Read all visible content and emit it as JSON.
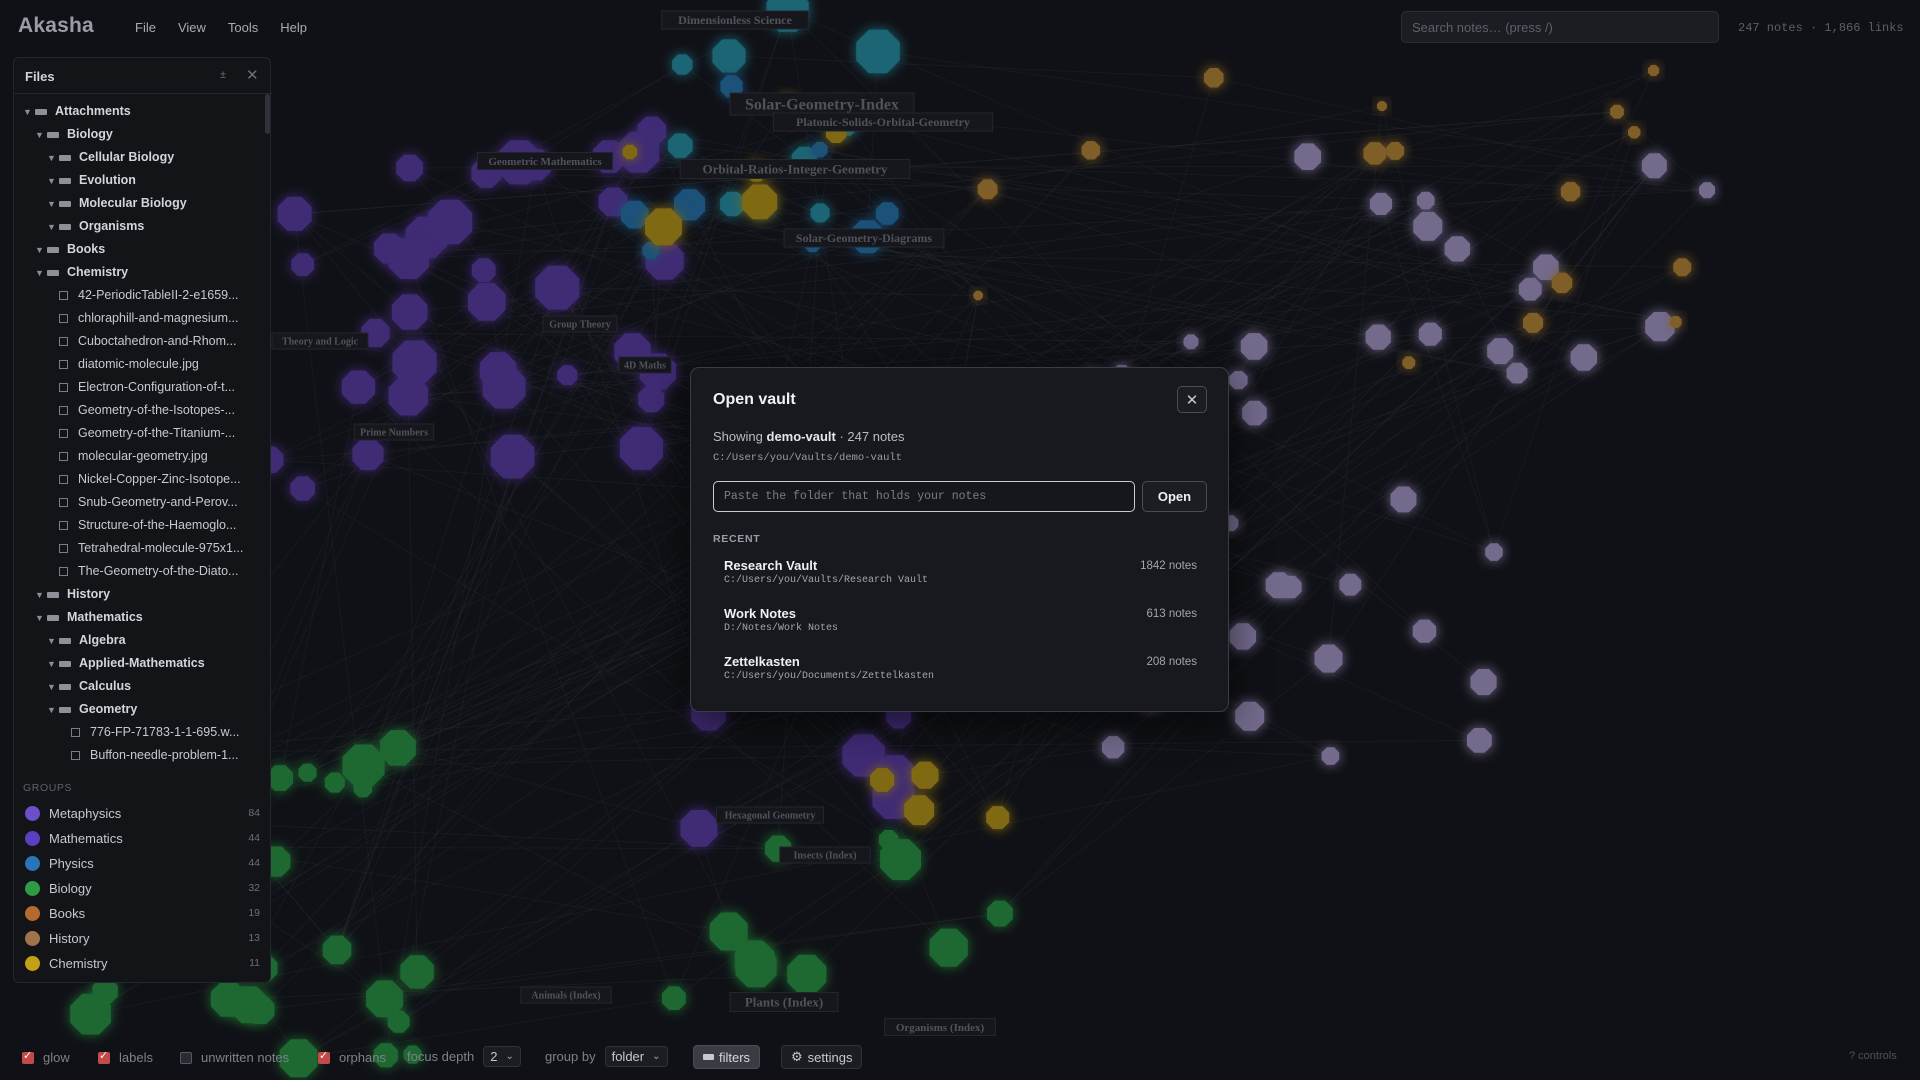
{
  "app": {
    "title": "Akasha"
  },
  "menu": [
    "File",
    "View",
    "Tools",
    "Help"
  ],
  "search": {
    "placeholder": "Search notes… (press /)"
  },
  "stats": "247 notes · 1,866 links",
  "graph": {
    "labels": [
      "Dimensionless Science",
      "Solar-Geometry-Index",
      "Platonic-Solids-Orbital-Geometry",
      "Orbital-Ratios-Integer-Geometry",
      "Solar-Geometry-Diagrams",
      "Geometric Mathematics",
      "Group Theory",
      "Theory and Logic",
      "4D Maths",
      "Prime Numbers",
      "Hexagonal Geometry",
      "Insects (Index)",
      "Animals (Index)",
      "Plants (Index)",
      "Organisms (Index)"
    ],
    "colors": {
      "purple": "#6c44c9",
      "blue": "#2a8ad0",
      "teal": "#2bb0c9",
      "green": "#2fb54d",
      "yellow": "#e0b617",
      "orange": "#e0a33a",
      "lavender": "#c8b8f2"
    }
  },
  "files": {
    "title": "Files",
    "collapse_icon": "±",
    "close_icon": "✕",
    "tree": [
      {
        "label": "Attachments",
        "type": "folder",
        "depth": 0
      },
      {
        "label": "Biology",
        "type": "folder",
        "depth": 1
      },
      {
        "label": "Cellular Biology",
        "type": "folder",
        "depth": 2
      },
      {
        "label": "Evolution",
        "type": "folder",
        "depth": 2
      },
      {
        "label": "Molecular Biology",
        "type": "folder",
        "depth": 2
      },
      {
        "label": "Organisms",
        "type": "folder",
        "depth": 2
      },
      {
        "label": "Books",
        "type": "folder",
        "depth": 1
      },
      {
        "label": "Chemistry",
        "type": "folder",
        "depth": 1
      },
      {
        "label": "42-PeriodicTableII-2-e1659...",
        "type": "file",
        "depth": 2
      },
      {
        "label": "chloraphill-and-magnesium...",
        "type": "file",
        "depth": 2
      },
      {
        "label": "Cuboctahedron-and-Rhom...",
        "type": "file",
        "depth": 2
      },
      {
        "label": "diatomic-molecule.jpg",
        "type": "file",
        "depth": 2
      },
      {
        "label": "Electron-Configuration-of-t...",
        "type": "file",
        "depth": 2
      },
      {
        "label": "Geometry-of-the-Isotopes-...",
        "type": "file",
        "depth": 2
      },
      {
        "label": "Geometry-of-the-Titanium-...",
        "type": "file",
        "depth": 2
      },
      {
        "label": "molecular-geometry.jpg",
        "type": "file",
        "depth": 2
      },
      {
        "label": "Nickel-Copper-Zinc-Isotope...",
        "type": "file",
        "depth": 2
      },
      {
        "label": "Snub-Geometry-and-Perov...",
        "type": "file",
        "depth": 2
      },
      {
        "label": "Structure-of-the-Haemoglo...",
        "type": "file",
        "depth": 2
      },
      {
        "label": "Tetrahedral-molecule-975x1...",
        "type": "file",
        "depth": 2
      },
      {
        "label": "The-Geometry-of-the-Diato...",
        "type": "file",
        "depth": 2
      },
      {
        "label": "History",
        "type": "folder",
        "depth": 1
      },
      {
        "label": "Mathematics",
        "type": "folder",
        "depth": 1
      },
      {
        "label": "Algebra",
        "type": "folder",
        "depth": 2
      },
      {
        "label": "Applied-Mathematics",
        "type": "folder",
        "depth": 2
      },
      {
        "label": "Calculus",
        "type": "folder",
        "depth": 2
      },
      {
        "label": "Geometry",
        "type": "folder",
        "depth": 2
      },
      {
        "label": "776-FP-71783-1-1-695.w...",
        "type": "file",
        "depth": 3
      },
      {
        "label": "Buffon-needle-problem-1...",
        "type": "file",
        "depth": 3
      }
    ]
  },
  "groups": {
    "title": "GROUPS",
    "items": [
      {
        "name": "Metaphysics",
        "count": "84",
        "color": "#6a4fc9"
      },
      {
        "name": "Mathematics",
        "count": "44",
        "color": "#5b3fc0"
      },
      {
        "name": "Physics",
        "count": "44",
        "color": "#2a74b8"
      },
      {
        "name": "Biology",
        "count": "32",
        "color": "#2f9a45"
      },
      {
        "name": "Books",
        "count": "19",
        "color": "#b46a2c"
      },
      {
        "name": "History",
        "count": "13",
        "color": "#a0744a"
      },
      {
        "name": "Chemistry",
        "count": "11",
        "color": "#c4a017"
      }
    ]
  },
  "bottom": {
    "glow": "glow",
    "labels": "labels",
    "unwritten": "unwritten notes",
    "orphans": "orphans",
    "focus_depth_label": "focus depth",
    "focus_depth_value": "2",
    "group_by_label": "group by",
    "group_by_value": "folder",
    "filters": "filters",
    "filters_icon": "filter-icon",
    "settings": "settings",
    "settings_icon": "⚙",
    "controls_hint": "? controls"
  },
  "modal": {
    "title": "Open vault",
    "close_icon": "✕",
    "showing_prefix": "Showing",
    "vault_name": "demo-vault",
    "showing_suffix": "· 247 notes",
    "vault_path": "C:/Users/you/Vaults/demo-vault",
    "input_placeholder": "Paste the folder that holds your notes",
    "open_label": "Open",
    "recent_title": "RECENT",
    "recent": [
      {
        "name": "Research Vault",
        "path": "C:/Users/you/Vaults/Research Vault",
        "count": "1842 notes"
      },
      {
        "name": "Work Notes",
        "path": "D:/Notes/Work Notes",
        "count": "613 notes"
      },
      {
        "name": "Zettelkasten",
        "path": "C:/Users/you/Documents/Zettelkasten",
        "count": "208 notes"
      }
    ]
  }
}
